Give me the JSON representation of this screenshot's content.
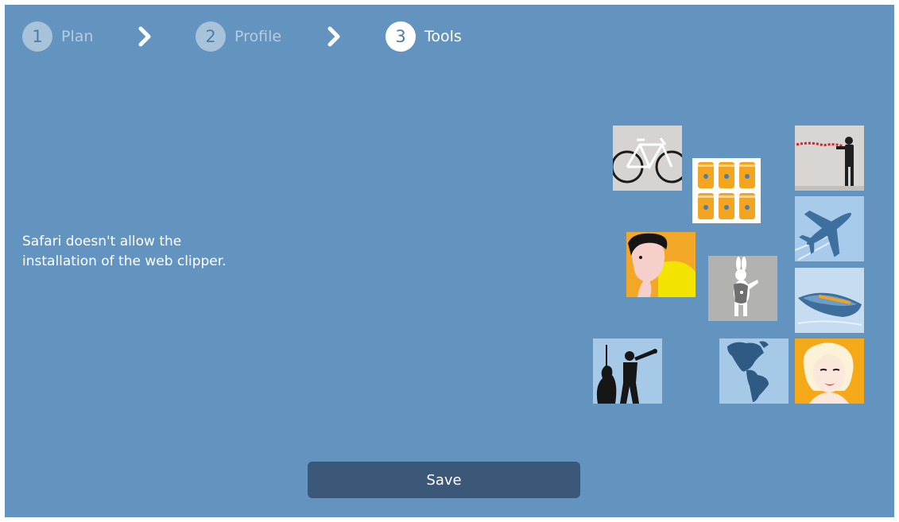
{
  "colors": {
    "background": "#6394c0",
    "save_button": "#3b5878",
    "step_inactive": "#a8c2d9",
    "step_active": "#ffffff"
  },
  "stepper": {
    "steps": [
      {
        "number": "1",
        "label": "Plan",
        "state": "inactive"
      },
      {
        "number": "2",
        "label": "Profile",
        "state": "inactive"
      },
      {
        "number": "3",
        "label": "Tools",
        "state": "active"
      }
    ],
    "separator_icon": "chevron-right-icon"
  },
  "message": {
    "line1": "Safari doesn't allow the",
    "line2": "installation of the web clipper."
  },
  "illustrations": [
    "bicycle-icon",
    "soup-cans-icon",
    "soldier-icon",
    "airplane-icon",
    "woman-portrait-icon",
    "white-rabbit-icon",
    "rowboat-icon",
    "jazz-musicians-icon",
    "americas-map-icon",
    "marilyn-portrait-icon"
  ],
  "footer": {
    "save_label": "Save"
  }
}
